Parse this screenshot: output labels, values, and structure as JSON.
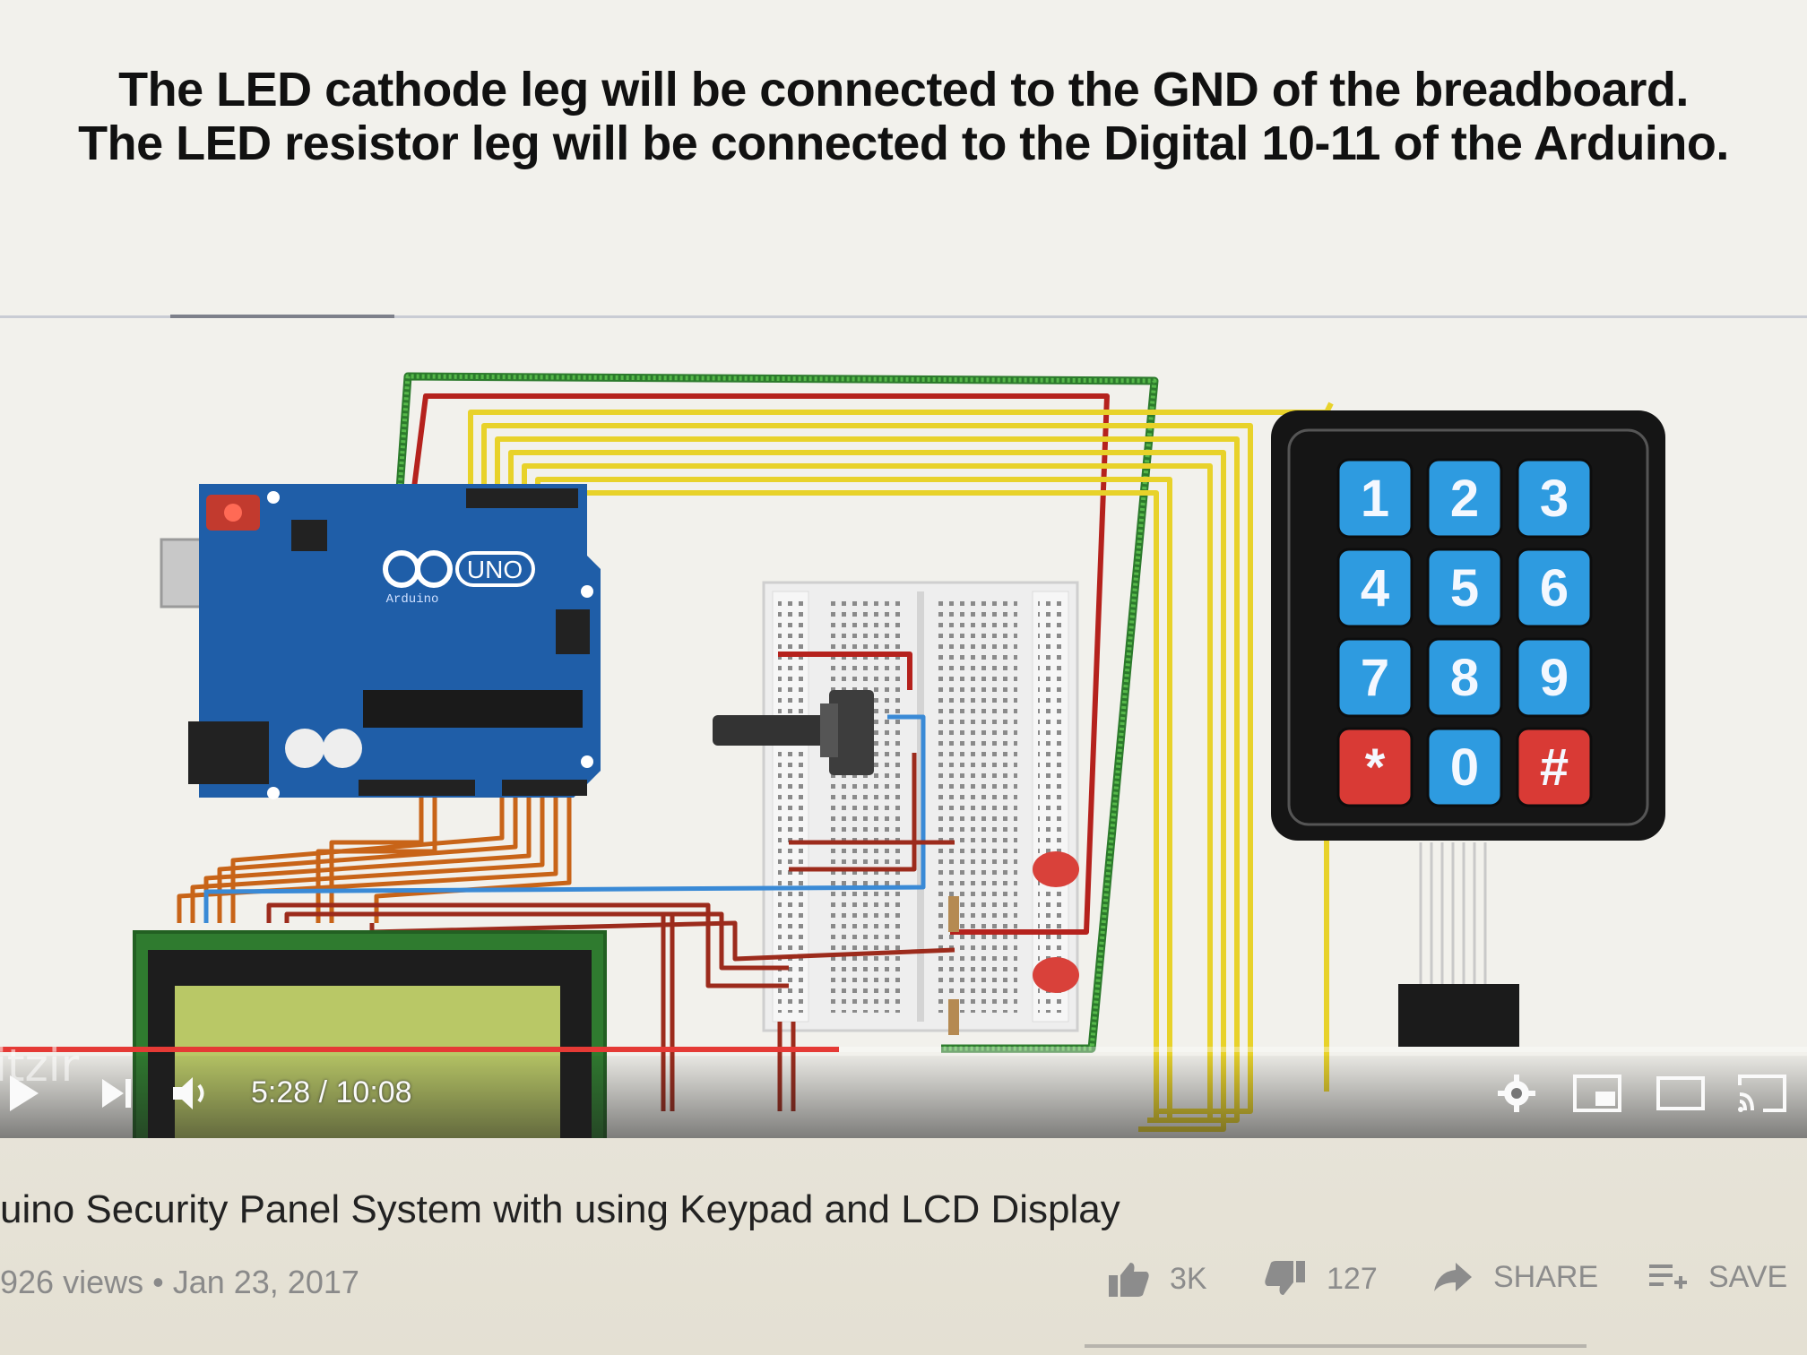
{
  "slide": {
    "caption_line1": "The LED cathode leg will be connected to the GND of the breadboard.",
    "caption_line2": "The LED resistor leg will be connected to the Digital 10-11 of the Arduino."
  },
  "board": {
    "logo_text": "UNO",
    "brand_text": "Arduino"
  },
  "keypad": {
    "keys": [
      "1",
      "2",
      "3",
      "4",
      "5",
      "6",
      "7",
      "8",
      "9",
      "*",
      "0",
      "#"
    ]
  },
  "player": {
    "time_display": "5:28 / 10:08",
    "progress": 0.54,
    "watermark": "itzir"
  },
  "video": {
    "title": "uino Security Panel System with using Keypad and LCD Display",
    "views": "926 views",
    "date": "Jan 23, 2017"
  },
  "actions": {
    "likes": "3K",
    "dislikes": "127",
    "share_label": "SHARE",
    "save_label": "SAVE"
  },
  "colors": {
    "progress": "#e53a35",
    "arduino_board": "#1f5ea8",
    "key_blue": "#2e9be0",
    "key_red": "#d93a35",
    "wire_yellow": "#e8d22a",
    "wire_red": "#b5221d",
    "wire_green": "#3a9a3a",
    "wire_orange": "#c86418",
    "wire_blue": "#3a8ad6",
    "lcd_screen": "#b9c866"
  }
}
